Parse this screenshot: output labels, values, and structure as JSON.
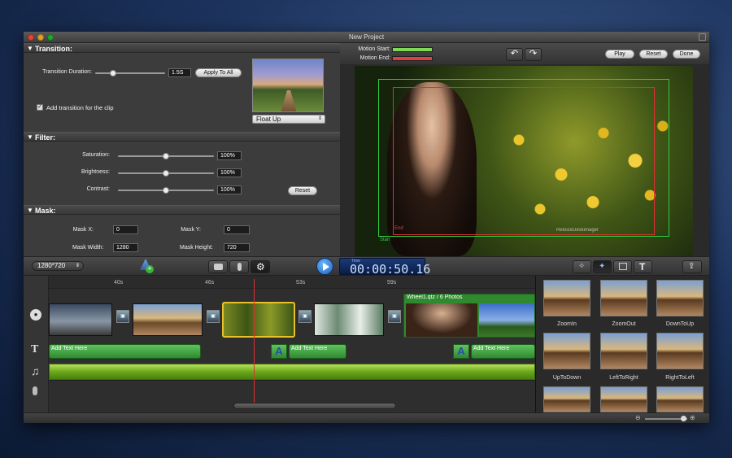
{
  "window": {
    "title": "New Project"
  },
  "transition": {
    "section": "Transition:",
    "duration_label": "Transition Duration:",
    "duration_value": "1.5S",
    "apply_all": "Apply To All",
    "add_clip": "Add transition for the clip",
    "effect": "Float Up",
    "duration_fraction": 0.25
  },
  "filter": {
    "section": "Filter:",
    "saturation_label": "Saturation:",
    "saturation_value": "100%",
    "brightness_label": "Brightness:",
    "brightness_value": "100%",
    "contrast_label": "Contrast:",
    "contrast_value": "100%",
    "reset": "Reset"
  },
  "mask": {
    "section": "Mask:",
    "x_label": "Mask X:",
    "x_value": "0",
    "y_label": "Mask Y:",
    "y_value": "0",
    "w_label": "Mask Width:",
    "w_value": "1280",
    "h_label": "Mask Height:",
    "h_value": "720"
  },
  "motion": {
    "start_label": "Motion Start:",
    "end_label": "Motion End:",
    "start_color": "#7ed957",
    "end_color": "#e04040"
  },
  "preview_actions": {
    "play": "Play",
    "reset": "Reset",
    "done": "Done"
  },
  "overlay": {
    "end_label": "End",
    "start_label": "Start",
    "watermark": "ReloiceDeskimager"
  },
  "toolbar": {
    "resolution": "1280*720",
    "timecode_small": "Time",
    "timecode": "00:00:50.16"
  },
  "ruler": [
    "40s",
    "46s",
    "53s",
    "59s"
  ],
  "clips": {
    "group_label": "Wheel1.qtz / 6 Photos"
  },
  "text_clips": [
    "Add Text Here",
    "Add Text Here",
    "Add Text Here"
  ],
  "library": [
    "ZoomIn",
    "ZoomOut",
    "DownToUp",
    "UpToDown",
    "LeftToRight",
    "RightToLeft"
  ],
  "accent": "#2f7fd6"
}
